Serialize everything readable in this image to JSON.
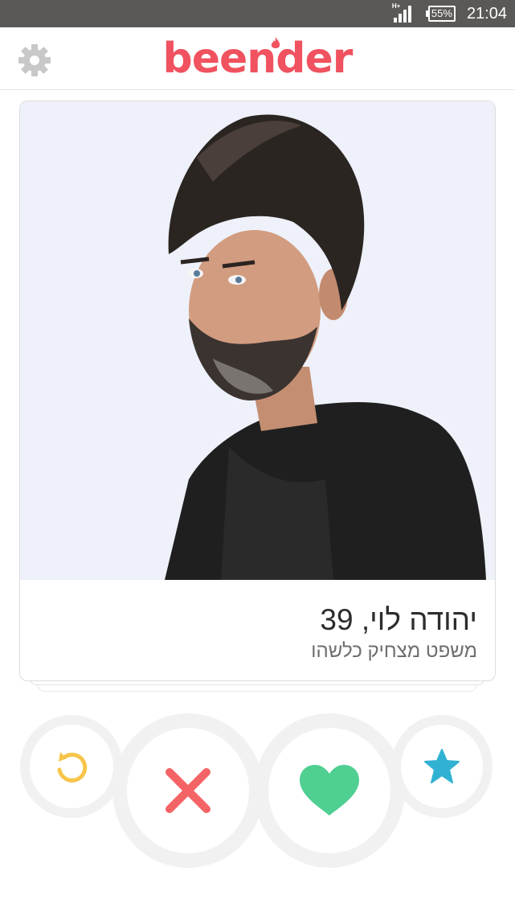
{
  "status_bar": {
    "network": "H+",
    "battery": "55%",
    "time": "21:04"
  },
  "header": {
    "logo_text": "beender",
    "brand_color": "#f0525f",
    "settings_icon": "gear-icon"
  },
  "profile": {
    "name_age": "יהודה לוי, 39",
    "tagline": "משפט מצחיק כלשהו"
  },
  "actions": {
    "undo_icon": "undo-icon",
    "undo_color": "#f7c54a",
    "nope_icon": "close-icon",
    "nope_color": "#f46466",
    "like_icon": "heart-icon",
    "like_color": "#4fcf91",
    "star_icon": "star-icon",
    "star_color": "#31b2d3"
  }
}
